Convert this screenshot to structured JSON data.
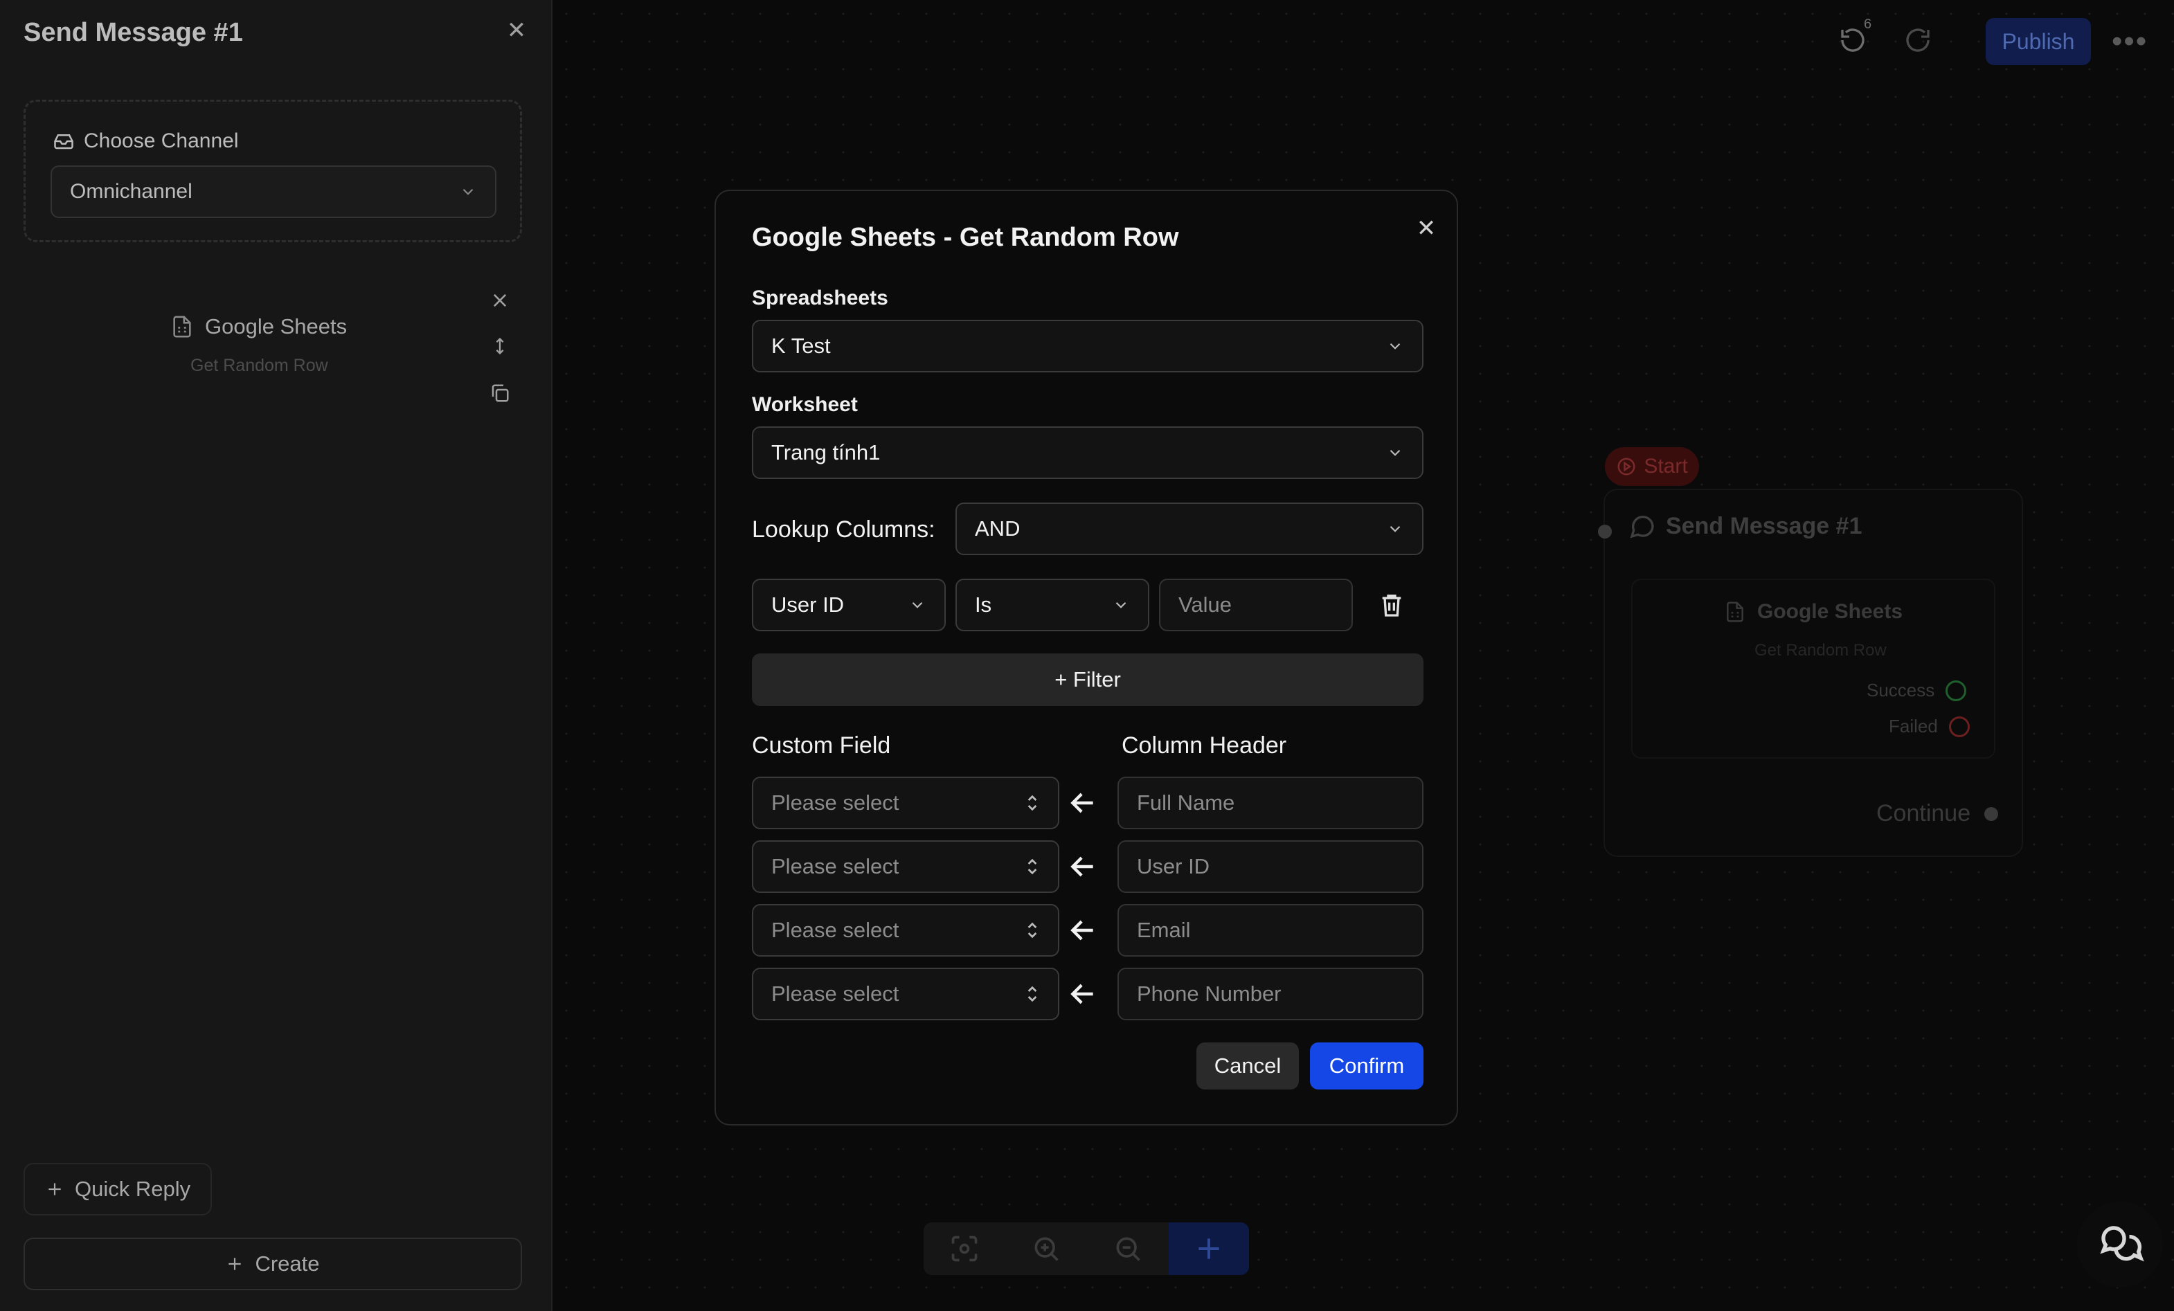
{
  "panel": {
    "title": "Send Message #1",
    "channel_label": "Choose Channel",
    "channel_value": "Omnichannel",
    "sheet_item_title": "Google Sheets",
    "sheet_item_sub": "Get Random Row",
    "quick_reply": "Quick Reply",
    "create": "Create"
  },
  "toolbar": {
    "undo_count": "6",
    "publish": "Publish",
    "more": "•••"
  },
  "node": {
    "start": "Start",
    "title": "Send Message #1",
    "sheet_title": "Google Sheets",
    "sheet_sub": "Get Random Row",
    "success": "Success",
    "failed": "Failed",
    "continue": "Continue",
    "colors": {
      "success": "#1f5f2e",
      "failed": "#6b1f1f"
    }
  },
  "modal": {
    "title": "Google Sheets - Get Random Row",
    "spreadsheets_label": "Spreadsheets",
    "spreadsheet_value": "K Test",
    "worksheet_label": "Worksheet",
    "worksheet_value": "Trang tính1",
    "lookup_label": "Lookup Columns:",
    "lookup_value": "AND",
    "filter": {
      "column": "User ID",
      "operator": "Is",
      "value_placeholder": "Value"
    },
    "add_filter": "+ Filter",
    "custom_field_header": "Custom Field",
    "column_header_header": "Column Header",
    "mappings": [
      {
        "custom_field": "Please select",
        "column_header": "Full Name"
      },
      {
        "custom_field": "Please select",
        "column_header": "User ID"
      },
      {
        "custom_field": "Please select",
        "column_header": "Email"
      },
      {
        "custom_field": "Please select",
        "column_header": "Phone Number"
      }
    ],
    "cancel": "Cancel",
    "confirm": "Confirm"
  },
  "colors": {
    "accent": "#1447e6",
    "background": "#0b0b0b"
  }
}
